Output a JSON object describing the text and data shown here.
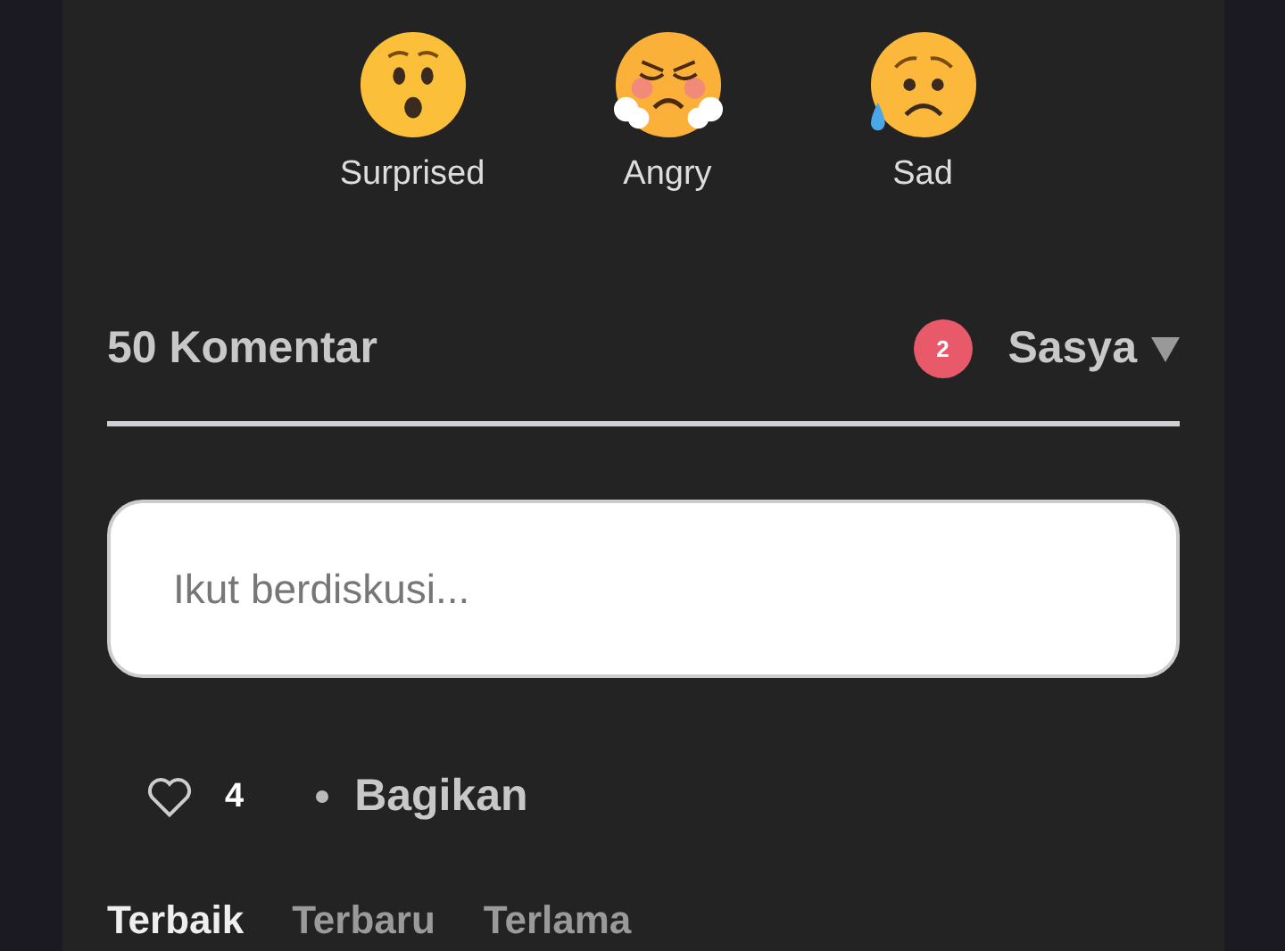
{
  "reactions": [
    {
      "kind": "surprised",
      "label": "Surprised"
    },
    {
      "kind": "angry",
      "label": "Angry"
    },
    {
      "kind": "sad",
      "label": "Sad"
    }
  ],
  "comments": {
    "count_label": "50 Komentar",
    "notifications": "2",
    "user": "Sasya",
    "input": {
      "placeholder": "Ikut berdiskusi..."
    },
    "likes": "4",
    "share": "Bagikan"
  },
  "sort_tabs": [
    {
      "label": "Terbaik",
      "selected": true
    },
    {
      "label": "Terbaru",
      "selected": false
    },
    {
      "label": "Terlama",
      "selected": false
    }
  ]
}
